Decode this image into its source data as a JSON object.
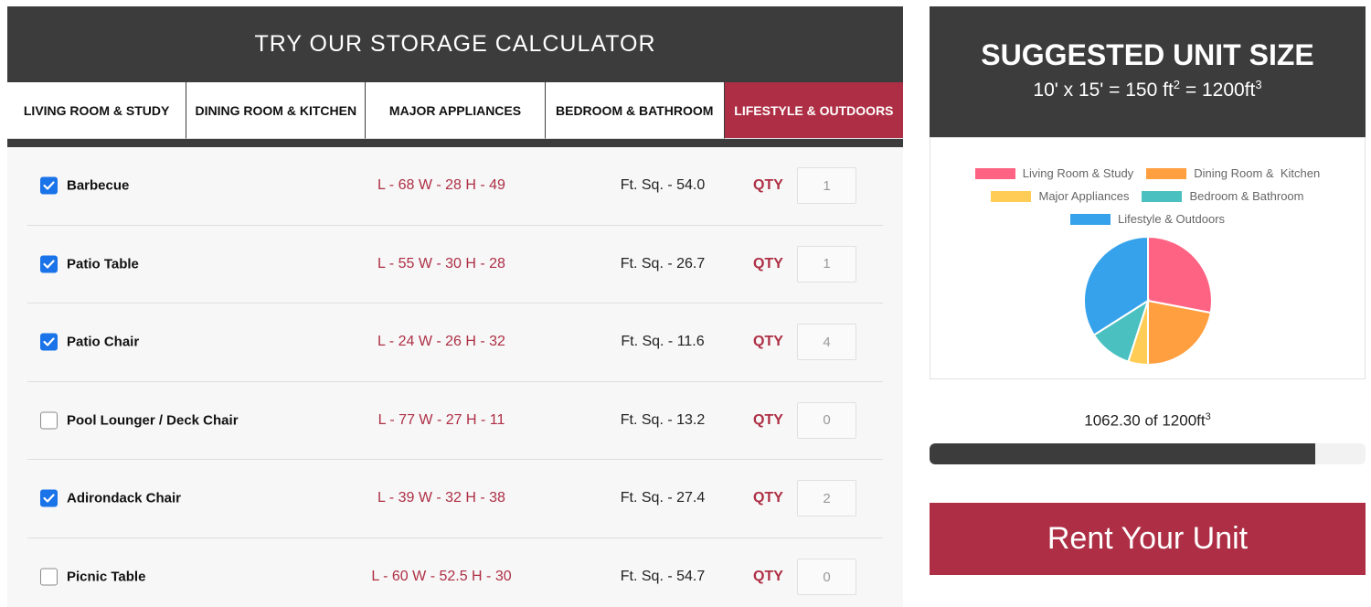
{
  "calculator": {
    "title": "TRY OUR STORAGE CALCULATOR",
    "tabs": [
      {
        "label": "LIVING ROOM & STUDY",
        "active": false
      },
      {
        "label": "DINING ROOM & KITCHEN",
        "active": false
      },
      {
        "label": "MAJOR APPLIANCES",
        "active": false
      },
      {
        "label": "BEDROOM & BATHROOM",
        "active": false
      },
      {
        "label": "LIFESTYLE & OUTDOORS",
        "active": true
      }
    ],
    "qty_label": "QTY",
    "items": [
      {
        "name": "Barbecue",
        "dims": "L - 68 W - 28 H - 49",
        "sqft": "Ft. Sq. - 54.0",
        "qty": "1",
        "checked": true
      },
      {
        "name": "Patio Table",
        "dims": "L - 55 W - 30 H - 28",
        "sqft": "Ft. Sq. - 26.7",
        "qty": "1",
        "checked": true
      },
      {
        "name": "Patio Chair",
        "dims": "L - 24 W - 26 H - 32",
        "sqft": "Ft. Sq. - 11.6",
        "qty": "4",
        "checked": true
      },
      {
        "name": "Pool Lounger / Deck Chair",
        "dims": "L - 77 W - 27 H - 11",
        "sqft": "Ft. Sq. - 13.2",
        "qty": "0",
        "checked": false
      },
      {
        "name": "Adirondack Chair",
        "dims": "L - 39 W - 32 H - 38",
        "sqft": "Ft. Sq. - 27.4",
        "qty": "2",
        "checked": true
      },
      {
        "name": "Picnic Table",
        "dims": "L - 60 W - 52.5 H - 30",
        "sqft": "Ft. Sq. - 54.7",
        "qty": "0",
        "checked": false
      }
    ]
  },
  "suggestion": {
    "title": "SUGGESTED UNIT SIZE",
    "formula_prefix": "10' x 15' = 150 ft",
    "formula_sup1": "2",
    "formula_mid": " = 1200ft",
    "formula_sup2": "3"
  },
  "chart_data": {
    "type": "pie",
    "categories": [
      "Living Room & Study",
      "Dining Room &  Kitchen",
      "Major Appliances",
      "Bedroom & Bathroom",
      "Lifestyle & Outdoors"
    ],
    "values": [
      28,
      22,
      5,
      11,
      34
    ],
    "colors": [
      "#ff6384",
      "#ff9f40",
      "#ffcd56",
      "#4bc0c0",
      "#36a2eb"
    ],
    "legend_position": "top"
  },
  "usage": {
    "text": "1062.30 of 1200ft",
    "sup": "3",
    "fraction": 0.885
  },
  "colors": {
    "accent": "#ae2f45",
    "dark": "#3c3c3c",
    "checkbox": "#1a73e8"
  },
  "rent_button": "Rent Your Unit"
}
